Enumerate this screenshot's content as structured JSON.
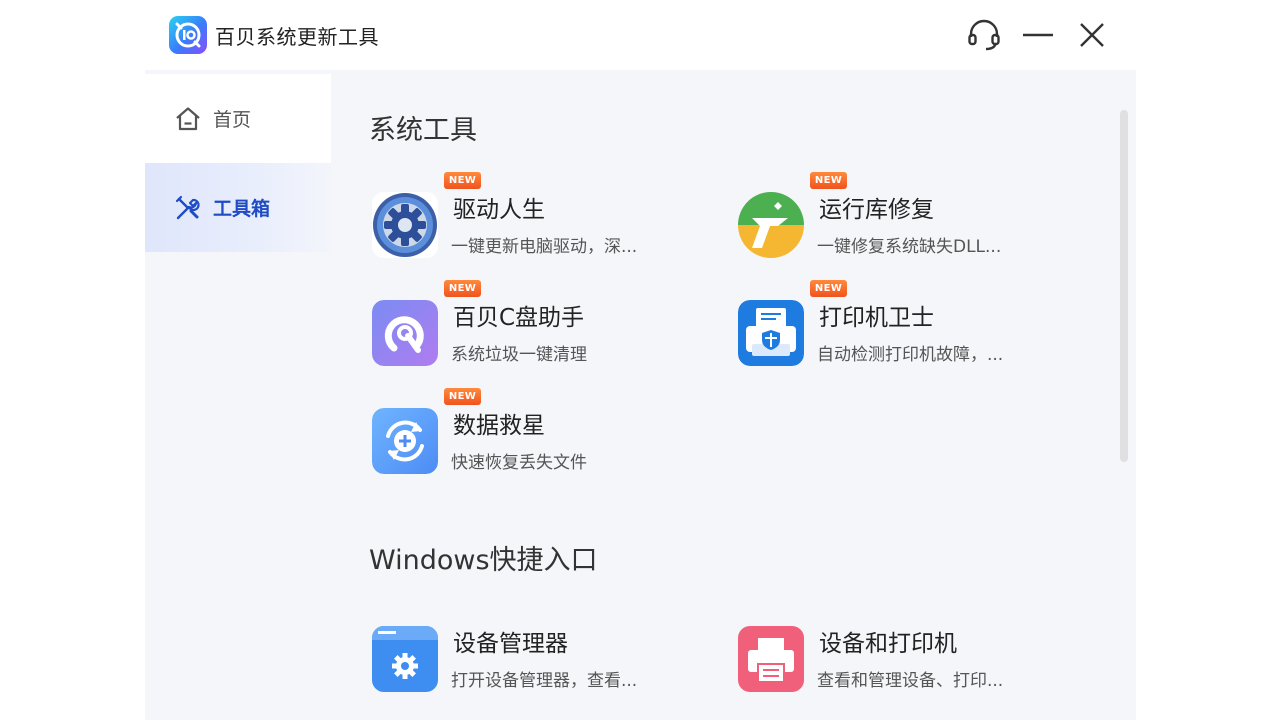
{
  "app": {
    "title": "百贝系统更新工具"
  },
  "sidebar": {
    "items": [
      {
        "label": "首页",
        "icon": "home-icon"
      },
      {
        "label": "工具箱",
        "icon": "tools-icon"
      }
    ]
  },
  "sections": {
    "system_tools": {
      "title": "系统工具",
      "items": [
        {
          "name": "驱动人生",
          "desc": "一键更新电脑驱动，深...",
          "badge": "NEW"
        },
        {
          "name": "运行库修复",
          "desc": "一键修复系统缺失DLL...",
          "badge": "NEW"
        },
        {
          "name": "百贝C盘助手",
          "desc": "系统垃圾一键清理",
          "badge": "NEW"
        },
        {
          "name": "打印机卫士",
          "desc": "自动检测打印机故障，...",
          "badge": "NEW"
        },
        {
          "name": "数据救星",
          "desc": "快速恢复丢失文件",
          "badge": "NEW"
        }
      ]
    },
    "windows_shortcuts": {
      "title": "Windows快捷入口",
      "items": [
        {
          "name": "设备管理器",
          "desc": "打开设备管理器，查看..."
        },
        {
          "name": "设备和打印机",
          "desc": "查看和管理设备、打印..."
        }
      ]
    }
  },
  "colors": {
    "accent": "#1f4bc4",
    "badge": "#f0531e",
    "content_bg": "#f5f6fa"
  }
}
